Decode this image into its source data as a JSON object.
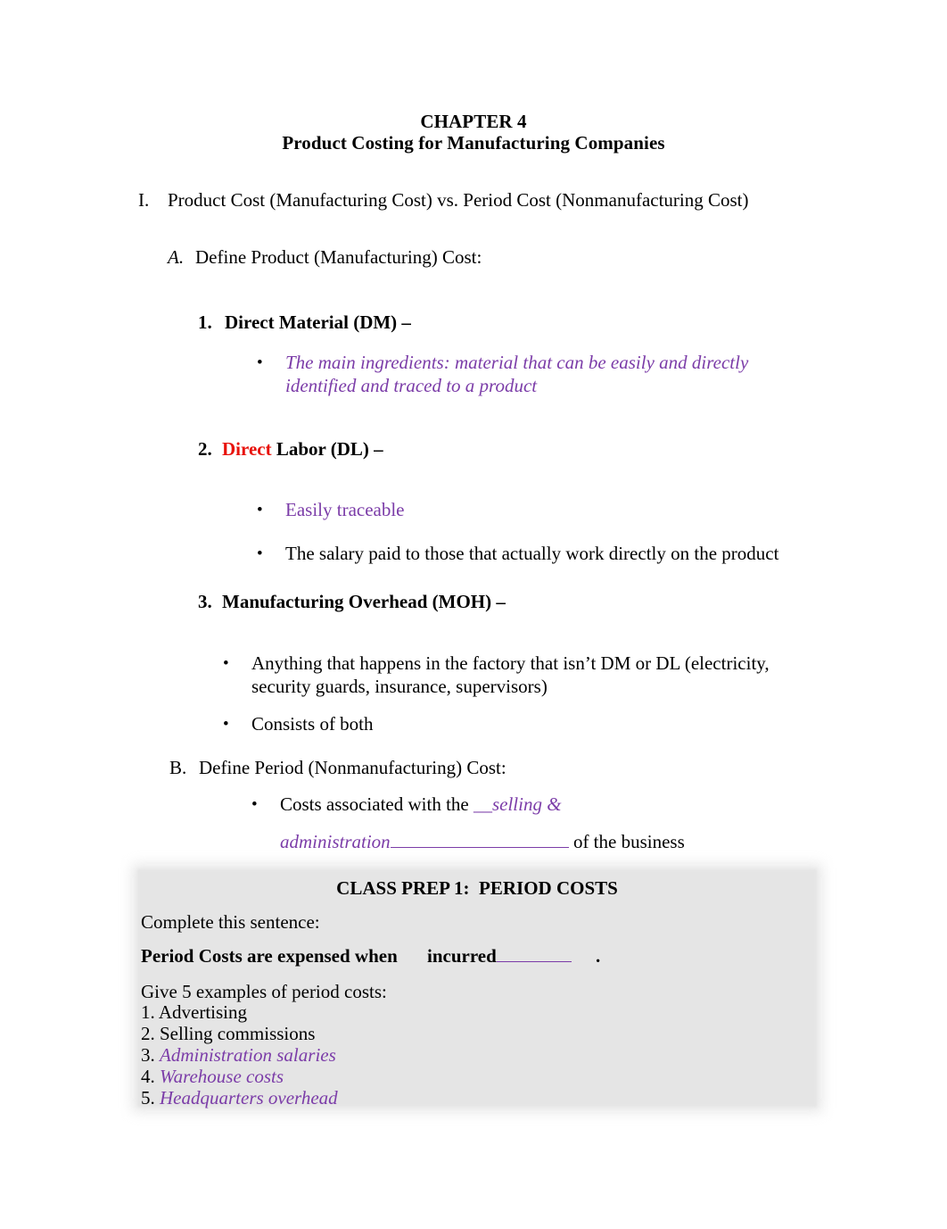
{
  "document": {
    "title": "CHAPTER 4",
    "subtitle": "Product Costing for Manufacturing Companies"
  },
  "colors": {
    "annotation_purple": "#7B3CA8",
    "emphasis_red": "#E8120B",
    "box_background": "#E5E5E5",
    "body_text": "#000000"
  },
  "outline": {
    "section_I": {
      "marker": "I.",
      "text": "Product Cost (Manufacturing Cost) vs. Period Cost (Nonmanufacturing Cost)"
    },
    "section_A": {
      "marker": "A.",
      "text": "Define Product (Manufacturing) Cost:",
      "items": [
        {
          "marker": "1.",
          "label": "Direct Material (DM) –",
          "bullets": [
            {
              "line1": "The main ingredients: material that can be easily and directly",
              "line2": "identified and traced to a product",
              "style": "purple-italic"
            }
          ]
        },
        {
          "marker": "2.",
          "label_red": "Direct",
          "label_rest": " Labor (DL) –",
          "bullets": [
            {
              "text": "Easily traceable",
              "style": "purple"
            },
            {
              "text": "The salary paid to those that actually work directly on the product",
              "style": "black"
            }
          ]
        },
        {
          "marker": "3.",
          "label": "Manufacturing Overhead (MOH) –",
          "bullets": [
            {
              "line1": "Anything that happens in the factory that isn’t DM or DL (electricity,",
              "line2": "security guards, insurance, supervisors)",
              "style": "black"
            },
            {
              "text": "Consists of both",
              "style": "black"
            }
          ]
        }
      ]
    },
    "section_B": {
      "marker": "B.",
      "text": "Define Period (Nonmanufacturing) Cost:",
      "bullet": {
        "lead": "Costs associated with the ",
        "answer_line1": "__selling &",
        "answer_line2": "administration",
        "trail": " of the business"
      }
    }
  },
  "class_prep": {
    "title": "CLASS PREP 1:  PERIOD COSTS",
    "instruction": "Complete this sentence:",
    "sentence_prompt": "Period Costs are expensed when",
    "sentence_answer": "incurred",
    "sentence_period": ".",
    "examples_prompt": "Give 5 examples of period costs:",
    "examples": [
      {
        "number": "1.",
        "text": "Advertising",
        "style": "black"
      },
      {
        "number": "2.",
        "text": "Selling commissions",
        "style": "black"
      },
      {
        "number": "3.",
        "text": "Administration salaries",
        "style": "purple-italic"
      },
      {
        "number": "4.",
        "text": "Warehouse costs",
        "style": "purple-italic"
      },
      {
        "number": "5.",
        "text": "Headquarters overhead",
        "style": "purple-italic"
      }
    ]
  }
}
